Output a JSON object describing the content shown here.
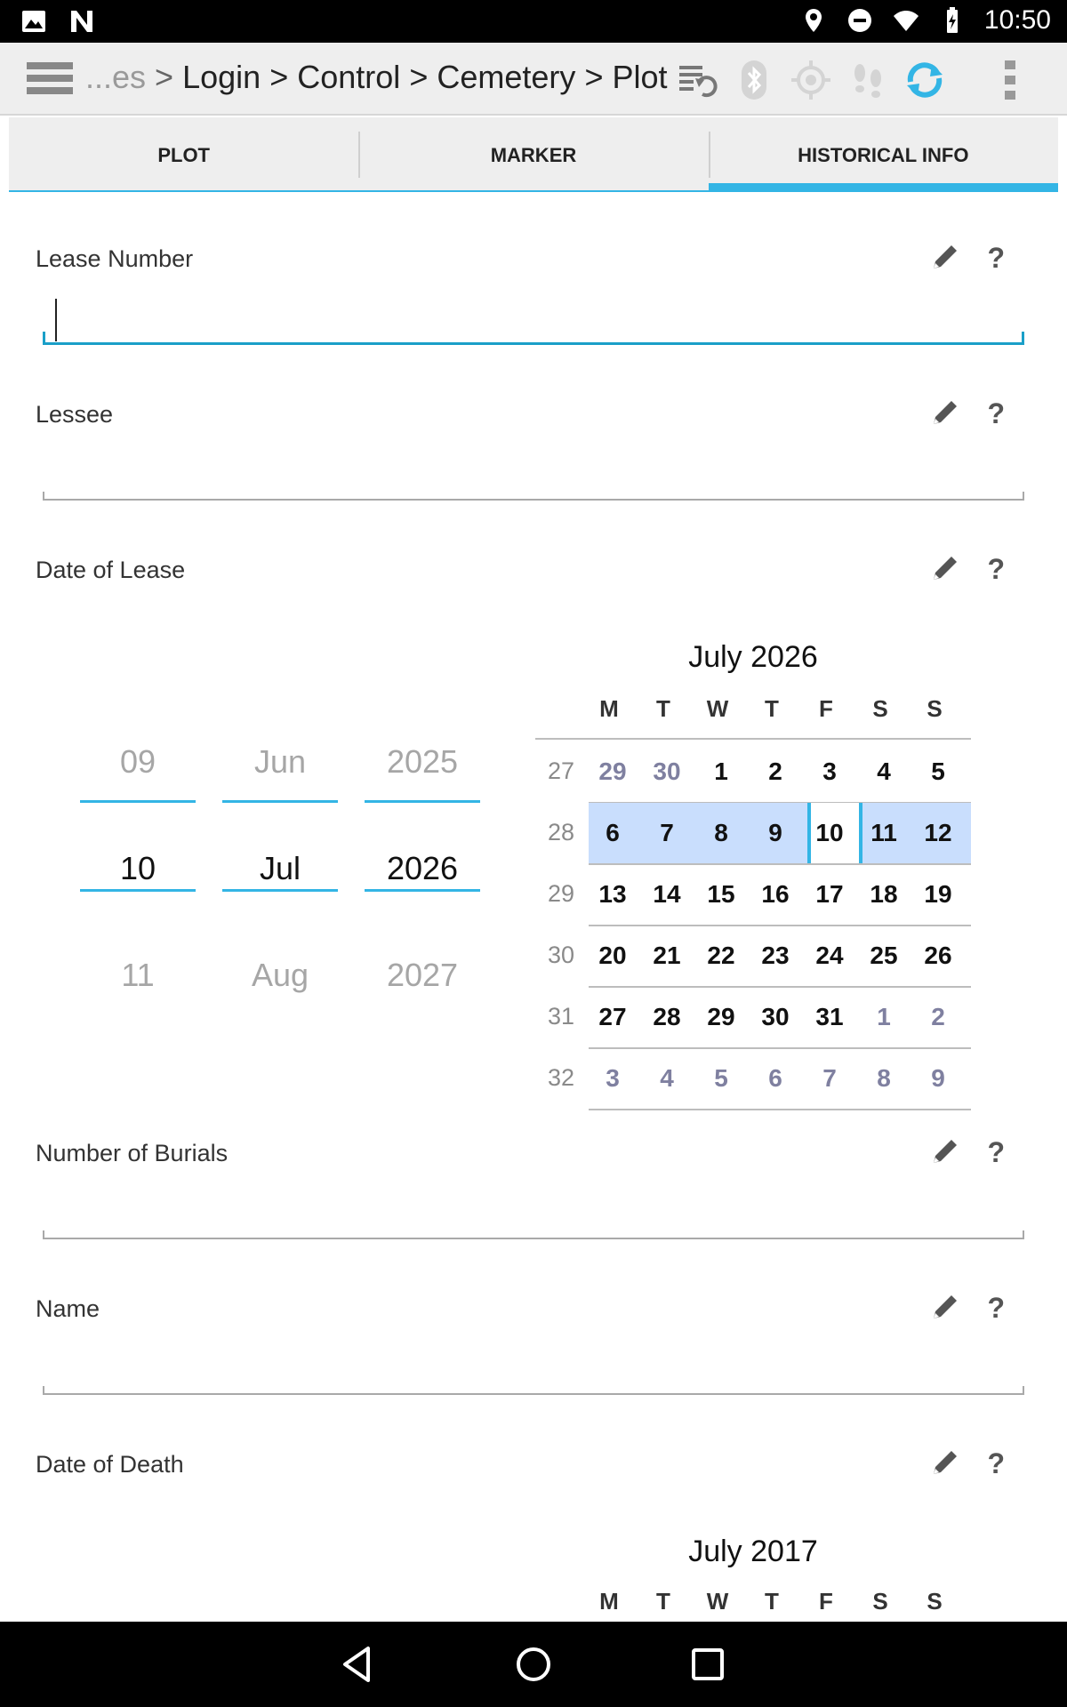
{
  "status_bar": {
    "time": "10:50"
  },
  "toolbar": {
    "breadcrumb_prefix": "...es",
    "breadcrumb": [
      "Login",
      "Control",
      "Cemetery",
      "Plot"
    ],
    "separator": ">"
  },
  "tabs": [
    {
      "label": "PLOT",
      "active": false
    },
    {
      "label": "MARKER",
      "active": false
    },
    {
      "label": "HISTORICAL INFO",
      "active": true
    }
  ],
  "fields": {
    "lease_number": {
      "label": "Lease Number",
      "value": ""
    },
    "lessee": {
      "label": "Lessee",
      "value": ""
    },
    "date_of_lease": {
      "label": "Date of Lease"
    },
    "number_of_burials": {
      "label": "Number of Burials",
      "value": ""
    },
    "name": {
      "label": "Name",
      "value": ""
    },
    "date_of_death": {
      "label": "Date of Death"
    }
  },
  "help_glyph": "?",
  "lease_picker": {
    "day": {
      "prev": "09",
      "selected": "10",
      "next": "11"
    },
    "month": {
      "prev": "Jun",
      "selected": "Jul",
      "next": "Aug"
    },
    "year": {
      "prev": "2025",
      "selected": "2026",
      "next": "2027"
    }
  },
  "lease_calendar": {
    "title": "July 2026",
    "weekday_headers": [
      "M",
      "T",
      "W",
      "T",
      "F",
      "S",
      "S"
    ],
    "weeks": [
      {
        "num": "27",
        "days": [
          "29",
          "30",
          "1",
          "2",
          "3",
          "4",
          "5"
        ]
      },
      {
        "num": "28",
        "days": [
          "6",
          "7",
          "8",
          "9",
          "10",
          "11",
          "12"
        ]
      },
      {
        "num": "29",
        "days": [
          "13",
          "14",
          "15",
          "16",
          "17",
          "18",
          "19"
        ]
      },
      {
        "num": "30",
        "days": [
          "20",
          "21",
          "22",
          "23",
          "24",
          "25",
          "26"
        ]
      },
      {
        "num": "31",
        "days": [
          "27",
          "28",
          "29",
          "30",
          "31",
          "1",
          "2"
        ]
      },
      {
        "num": "32",
        "days": [
          "3",
          "4",
          "5",
          "6",
          "7",
          "8",
          "9"
        ]
      }
    ],
    "selected_day": "10"
  },
  "death_calendar": {
    "title": "July 2017",
    "weekday_headers": [
      "M",
      "T",
      "W",
      "T",
      "F",
      "S",
      "S"
    ]
  },
  "colors": {
    "accent": "#33b5e5",
    "week_highlight": "#c9defd",
    "input_focus": "#1a9fc8"
  }
}
